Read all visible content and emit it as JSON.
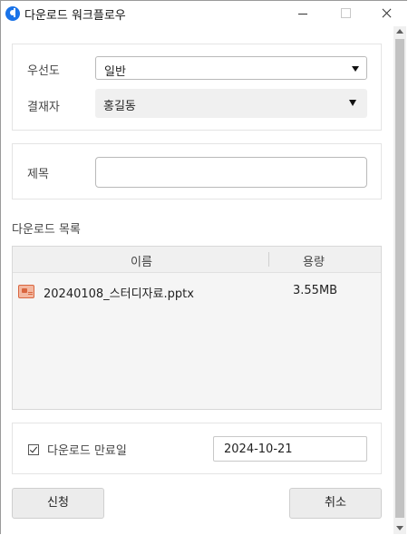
{
  "window": {
    "title": "다운로드 워크플로우"
  },
  "form": {
    "priority": {
      "label": "우선도",
      "value": "일반"
    },
    "approver": {
      "label": "결재자",
      "value": "홍길동"
    },
    "subject": {
      "label": "제목",
      "value": ""
    }
  },
  "downloads": {
    "section_title": "다운로드 목록",
    "columns": {
      "name": "이름",
      "size": "용량"
    },
    "rows": [
      {
        "name": "20240108_스터디자료.pptx",
        "size": "3.55MB",
        "icon": "pptx-file-icon"
      }
    ]
  },
  "expiry": {
    "checkbox_label": "다운로드 만료일",
    "checked": true,
    "date": "2024-10-21"
  },
  "actions": {
    "submit_label": "신청",
    "cancel_label": "취소"
  }
}
